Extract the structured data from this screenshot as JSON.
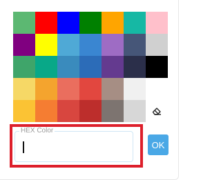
{
  "palette": {
    "rows": [
      [
        "#5cb872",
        "#ff0000",
        "#0000ff",
        "#008000",
        "#ffa500",
        "#16b8a4",
        "#ffc0cb"
      ],
      [
        "#800080",
        "#ffff00",
        "#4fa9d6",
        "#3a86d1",
        "#9e6cc4",
        "#465678",
        "#d0d0d0"
      ],
      [
        "#3fa56a",
        "#08a888",
        "#3a8bbd",
        "#2c6cb8",
        "#643a8f",
        "#2b2f4a",
        "#000000"
      ],
      [
        "#f6d866",
        "#f4a42e",
        "#ea6e5e",
        "#e2473f",
        "#a68e84",
        "#f0f0f0",
        ""
      ],
      [
        "#fbc334",
        "#f57d32",
        "#d8463f",
        "#bd2e2c",
        "#7d7470",
        "#d7d7d7",
        ""
      ]
    ]
  },
  "icons": {
    "eraser": "eraser-icon"
  },
  "hex_field": {
    "legend": "HEX Color",
    "value": "",
    "placeholder": ""
  },
  "ok_button": {
    "label": "OK",
    "color": "#4aa8e6"
  },
  "highlight": {
    "color": "#dd1f2b"
  }
}
